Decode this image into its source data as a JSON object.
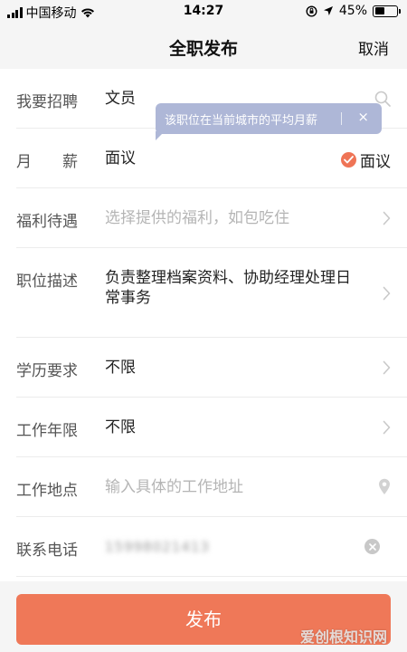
{
  "status_bar": {
    "carrier": "中国移动",
    "time": "14:27",
    "battery_percent": "45%",
    "battery_level": 0.45
  },
  "nav": {
    "title": "全职发布",
    "cancel_label": "取消"
  },
  "tooltip": {
    "text": "该职位在当前城市的平均月薪",
    "close_label": "×"
  },
  "form": {
    "position": {
      "label": "我要招聘",
      "value": "文员"
    },
    "salary": {
      "label": "月　　薪",
      "value": "面议",
      "negotiable_label": "面议",
      "negotiable_checked": true
    },
    "benefits": {
      "label": "福利待遇",
      "placeholder": "选择提供的福利，如包吃住"
    },
    "description": {
      "label": "职位描述",
      "value": "负责整理档案资料、协助经理处理日常事务"
    },
    "education": {
      "label": "学历要求",
      "value": "不限"
    },
    "experience": {
      "label": "工作年限",
      "value": "不限"
    },
    "address": {
      "label": "工作地点",
      "placeholder": "输入具体的工作地址"
    },
    "phone": {
      "label": "联系电话",
      "value": "15998021413"
    }
  },
  "publish_label": "发布",
  "watermark": "爱创根知识网",
  "colors": {
    "accent": "#ef7858",
    "tooltip_bg": "#aeb7d7"
  }
}
